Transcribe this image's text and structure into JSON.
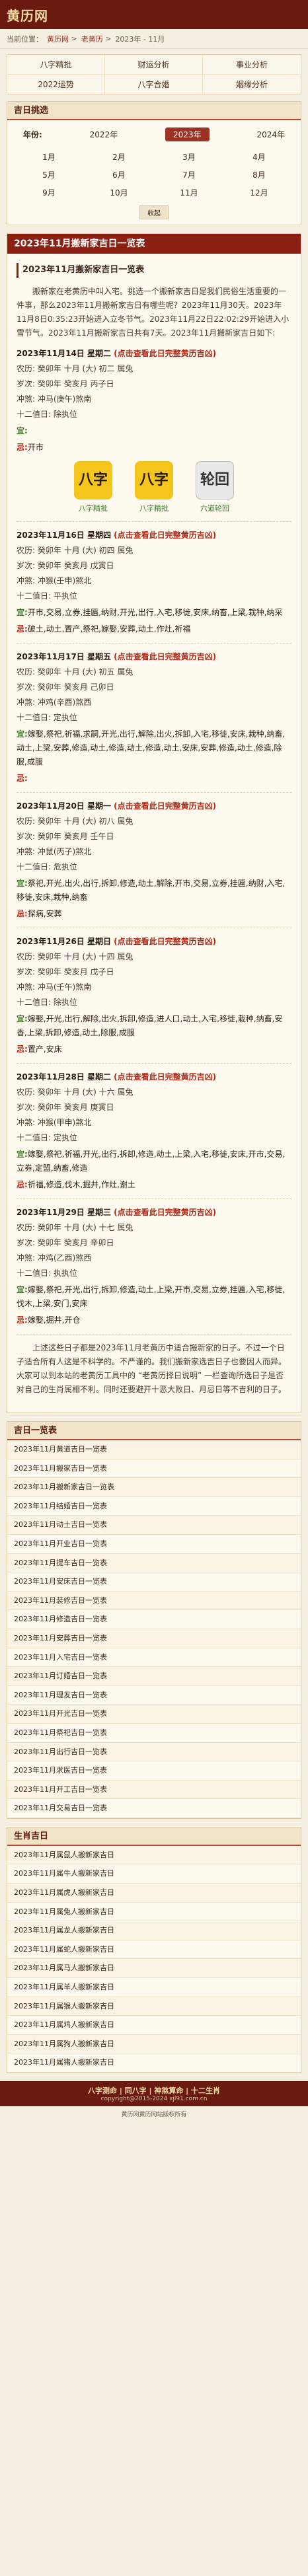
{
  "site": {
    "logo": "黄历网"
  },
  "crumbs": {
    "label": "当前位置：",
    "home": "黄历网",
    "section": "老黄历",
    "current": "2023年 - 11月"
  },
  "nav": [
    "八字精批",
    "财运分析",
    "事业分析",
    "2022运势",
    "八字合婚",
    "姻缘分析"
  ],
  "jiri": {
    "title": "吉日挑选",
    "year_label": "年份:",
    "years": [
      "2022年",
      "2023年",
      "2024年"
    ],
    "months": [
      "1月",
      "2月",
      "3月",
      "4月",
      "5月",
      "6月",
      "7月",
      "8月",
      "9月",
      "10月",
      "11月",
      "12月"
    ],
    "collapse": "收起"
  },
  "article": {
    "header": "2023年11月搬新家吉日一览表",
    "subhead": "2023年11月搬新家吉日一览表",
    "intro": "搬新家在老黄历中叫入宅。挑选一个搬新家吉日是我们民俗生活重要的一件事，那么2023年11月搬新家吉日有哪些呢？2023年11月30天。2023年11月8日0:35:23开始进入立冬节气。2023年11月22日22:02:29开始进入小雪节气。2023年11月搬新家吉日共有7天。2023年11月搬新家吉日如下:",
    "outro": "上述这些日子都是2023年11月老黄历中适合搬新家的日子。不过一个日子适合所有人这是不科学的。不严谨的。我们搬新家选吉日子也要因人而异。大家可以到本站的老黄历工具中的 “老黄历择日说明” 一栏查询所选日子是否对自己的生肖属相不利。同时还要避开十恶大败日、月忌日等不吉利的日子。",
    "labels": {
      "nongli": "农历:",
      "suici": "岁次:",
      "chong": "冲煞:",
      "zhishen": "十二值日:",
      "yi": "宜:",
      "ji": "忌:"
    },
    "days": [
      {
        "date": "2023年11月14日 星期二",
        "link": "(点击查看此日完整黄历吉凶)",
        "nongli": "癸卯年 十月 (大) 初二 属兔",
        "suici": "癸卯年 癸亥月 丙子日",
        "chong": "冲马(庚午)煞南",
        "zhishen": "除执位",
        "yi": "",
        "ji": "开市"
      },
      {
        "date": "2023年11月16日 星期四",
        "link": "(点击查看此日完整黄历吉凶)",
        "nongli": "癸卯年 十月 (大) 初四 属兔",
        "suici": "癸卯年 癸亥月 戊寅日",
        "chong": "冲猴(壬申)煞北",
        "zhishen": "平执位",
        "yi": "开市,交易,立券,挂匾,纳财,开光,出行,入宅,移徙,安床,纳畜,上梁,栽种,纳采",
        "ji": "破土,动土,置产,祭祀,嫁娶,安葬,动土,作灶,祈福"
      },
      {
        "date": "2023年11月17日 星期五",
        "link": "(点击查看此日完整黄历吉凶)",
        "nongli": "癸卯年 十月 (大) 初五 属兔",
        "suici": "癸卯年 癸亥月 己卯日",
        "chong": "冲鸡(辛酉)煞西",
        "zhishen": "定执位",
        "yi": "嫁娶,祭祀,祈福,求嗣,开光,出行,解除,出火,拆卸,入宅,移徙,安床,栽种,纳畜,动土,上梁,安葬,修造,动土,修造,动土,修造,动土,安床,安葬,修造,动土,修造,除服,成服",
        "ji": ""
      },
      {
        "date": "2023年11月20日 星期一",
        "link": "(点击查看此日完整黄历吉凶)",
        "nongli": "癸卯年 十月 (大) 初八 属兔",
        "suici": "癸卯年 癸亥月 壬午日",
        "chong": "冲鼠(丙子)煞北",
        "zhishen": "危执位",
        "yi": "祭祀,开光,出火,出行,拆卸,修造,动土,解除,开市,交易,立券,挂匾,纳财,入宅,移徙,安床,栽种,纳畜",
        "ji": "探病,安葬"
      },
      {
        "date": "2023年11月26日 星期日",
        "link": "(点击查看此日完整黄历吉凶)",
        "nongli": "癸卯年 十月 (大) 十四 属兔",
        "suici": "癸卯年 癸亥月 戊子日",
        "chong": "冲马(壬午)煞南",
        "zhishen": "除执位",
        "yi": "嫁娶,开光,出行,解除,出火,拆卸,修造,进人口,动土,入宅,移徙,栽种,纳畜,安香,上梁,拆卸,修造,动土,除服,成服",
        "ji": "置产,安床"
      },
      {
        "date": "2023年11月28日 星期二",
        "link": "(点击查看此日完整黄历吉凶)",
        "nongli": "癸卯年 十月 (大) 十六 属兔",
        "suici": "癸卯年 癸亥月 庚寅日",
        "chong": "冲猴(甲申)煞北",
        "zhishen": "定执位",
        "yi": "嫁娶,祭祀,祈福,开光,出行,拆卸,修造,动土,上梁,入宅,移徙,安床,开市,交易,立券,定盟,纳畜,修造",
        "ji": "祈福,修造,伐木,掘井,作灶,谢土"
      },
      {
        "date": "2023年11月29日 星期三",
        "link": "(点击查看此日完整黄历吉凶)",
        "nongli": "癸卯年 十月 (大) 十七 属兔",
        "suici": "癸卯年 癸亥月 辛卯日",
        "chong": "冲鸡(乙酉)煞西",
        "zhishen": "执执位",
        "yi": "嫁娶,祭祀,开光,出行,拆卸,修造,动土,上梁,开市,交易,立券,挂匾,入宅,移徙,伐木,上梁,安门,安床",
        "ji": "嫁娶,掘井,开仓"
      }
    ]
  },
  "apps": [
    {
      "name": "八字精批",
      "glyph": "八字"
    },
    {
      "name": "八字精批",
      "glyph": "八字"
    },
    {
      "name": "六道轮回",
      "glyph": "轮回"
    }
  ],
  "jiri_list": {
    "title": "吉日一览表",
    "items": [
      "2023年11月黄道吉日一览表",
      "2023年11月搬家吉日一览表",
      "2023年11月搬新家吉日一览表",
      "2023年11月结婚吉日一览表",
      "2023年11月动土吉日一览表",
      "2023年11月开业吉日一览表",
      "2023年11月提车吉日一览表",
      "2023年11月安床吉日一览表",
      "2023年11月装修吉日一览表",
      "2023年11月修造吉日一览表",
      "2023年11月安葬吉日一览表",
      "2023年11月入宅吉日一览表",
      "2023年11月订婚吉日一览表",
      "2023年11月理发吉日一览表",
      "2023年11月开光吉日一览表",
      "2023年11月祭祀吉日一览表",
      "2023年11月出行吉日一览表",
      "2023年11月求医吉日一览表",
      "2023年11月开工吉日一览表",
      "2023年11月交易吉日一览表"
    ]
  },
  "shengxiao_list": {
    "title": "生肖吉日",
    "items": [
      "2023年11月属鼠人搬新家吉日",
      "2023年11月属牛人搬新家吉日",
      "2023年11月属虎人搬新家吉日",
      "2023年11月属兔人搬新家吉日",
      "2023年11月属龙人搬新家吉日",
      "2023年11月属蛇人搬新家吉日",
      "2023年11月属马人搬新家吉日",
      "2023年11月属羊人搬新家吉日",
      "2023年11月属猴人搬新家吉日",
      "2023年11月属鸡人搬新家吉日",
      "2023年11月属狗人搬新家吉日",
      "2023年11月属猪人搬新家吉日"
    ]
  },
  "footer": {
    "links": "八字测命 | 同八字 | 神煞算命 | 十二生肖",
    "copy": "copyright@2015-2024 xjl91.com.cn",
    "icp": "黄历网黄历网站版权所有"
  }
}
